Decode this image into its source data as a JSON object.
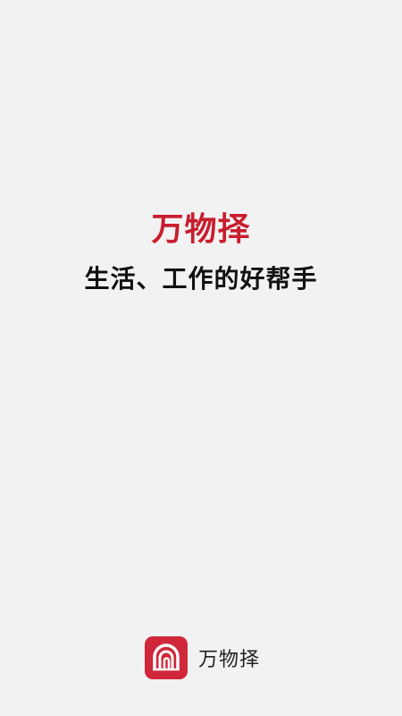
{
  "splash": {
    "title": "万物择",
    "slogan": "生活、工作的好帮手"
  },
  "footer": {
    "app_name": "万物择",
    "logo_icon": "arch-door-logo-icon"
  },
  "colors": {
    "background": "#f3f2f3",
    "brand_red": "#c81e2e",
    "logo_red": "#d0283a",
    "slogan_text": "#111111"
  }
}
